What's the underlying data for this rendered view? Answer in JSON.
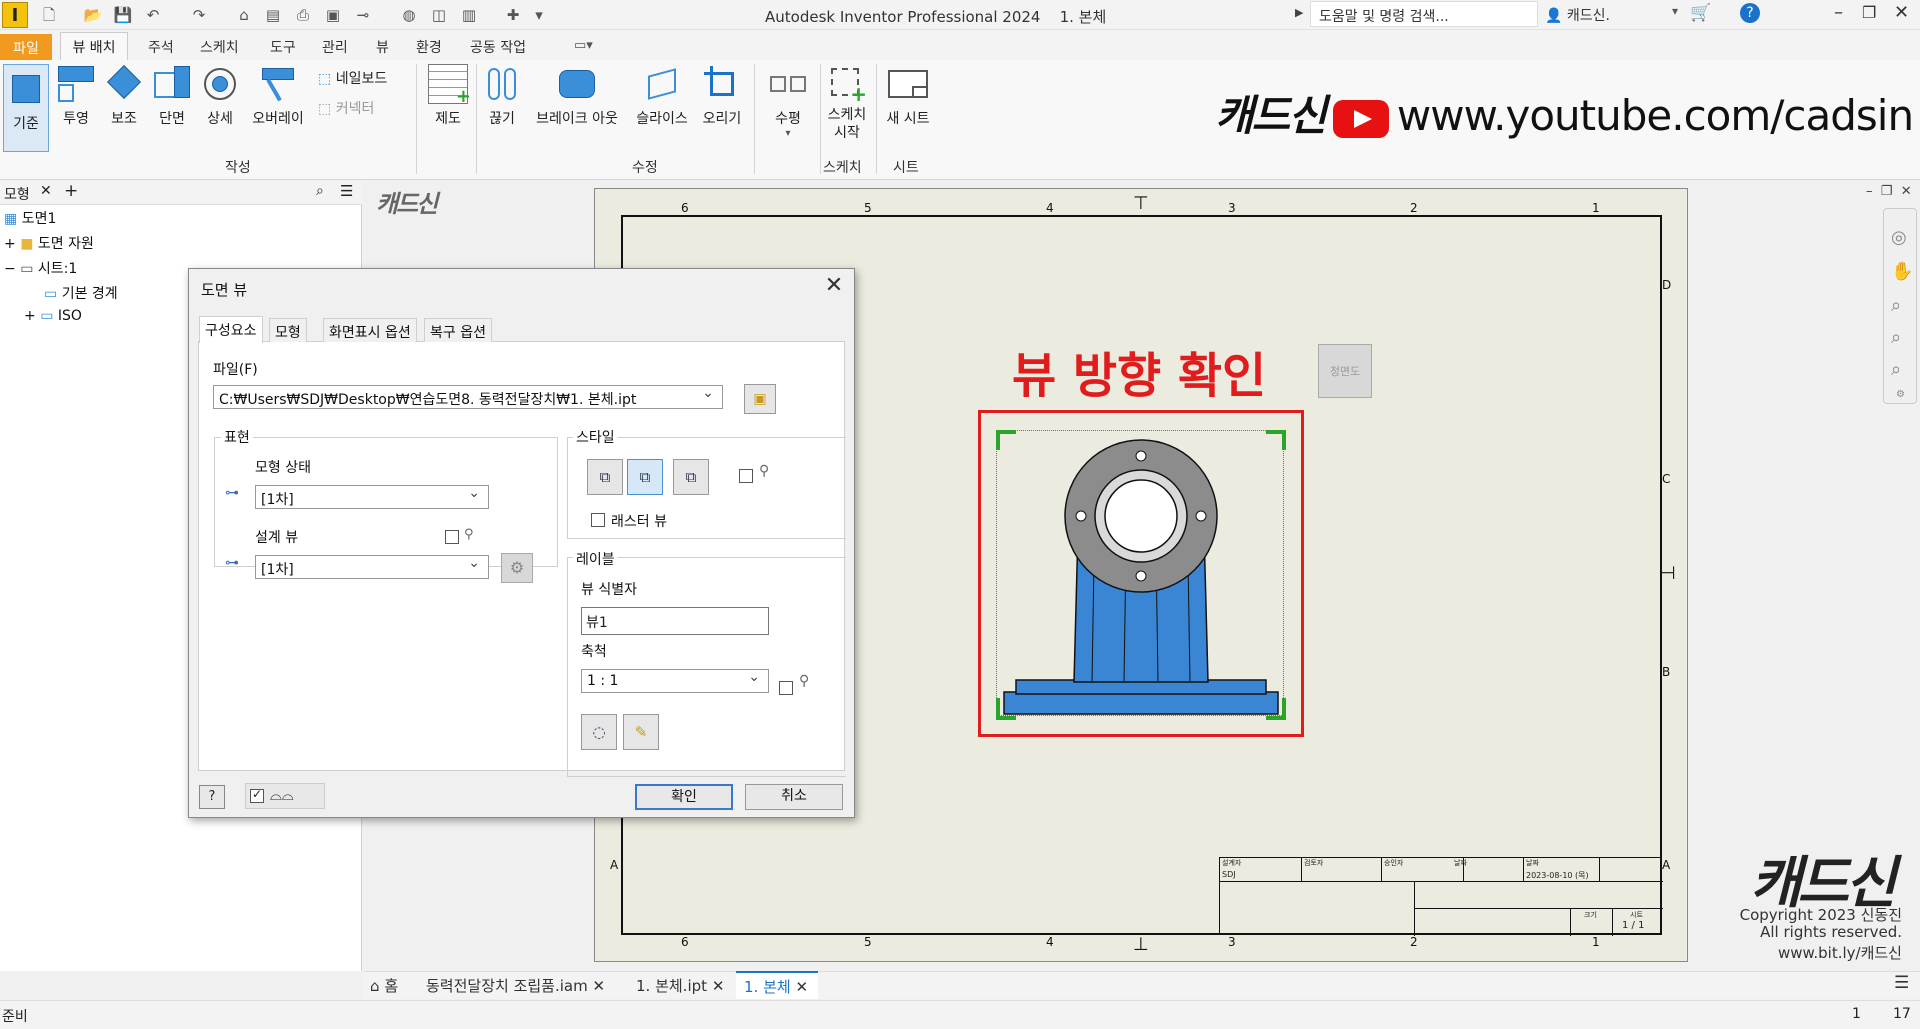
{
  "app": {
    "title": "Autodesk Inventor Professional 2024",
    "document": "1. 본체",
    "logo_letter": "I",
    "search_placeholder": "도움말 및 명령 검색...",
    "user": "캐드신."
  },
  "ribbon_tabs": [
    "파일",
    "뷰 배치",
    "주석",
    "스케치",
    "도구",
    "관리",
    "뷰",
    "환경",
    "공동 작업"
  ],
  "ribbon": {
    "create_buttons": [
      "기준",
      "투영",
      "보조",
      "단면",
      "상세",
      "오버레이"
    ],
    "small_buttons": [
      "네일보드",
      "커넥터"
    ],
    "draft_label": "제도",
    "modify_buttons": [
      "끊기",
      "브레이크 아웃",
      "슬라이스",
      "오리기"
    ],
    "align_label": "수평",
    "sketch_label_1": "스케치",
    "sketch_label_2": "시작",
    "new_sheet_label": "새 시트",
    "groups": {
      "create": "작성",
      "modify": "수정",
      "sketch": "스케치",
      "sheet": "시트"
    }
  },
  "brand": {
    "korean": "캐드신",
    "url": "www.youtube.com/cadsin"
  },
  "browser": {
    "tab": "모형",
    "tree": [
      "도면1",
      "도면 자원",
      "시트:1",
      "기본 경계",
      "ISO"
    ]
  },
  "canvas": {
    "watermark_top": "캐드신",
    "zone_cols": [
      "6",
      "5",
      "4",
      "3",
      "2",
      "1"
    ],
    "zone_rows": [
      "D",
      "C",
      "B",
      "A"
    ],
    "annotation": "뷰 방향 확인",
    "viewcube_label": "정면도",
    "titleblock": {
      "designer_h": "설계자",
      "checker_h": "검토자",
      "approver_h": "승인자",
      "date_h": "날짜",
      "date_h2": "날짜",
      "designer": "SDJ",
      "date": "2023-08-10 (목)",
      "sheet_h": "시트",
      "size_h": "크기",
      "sheet": "1 / 1"
    }
  },
  "watermark": {
    "logo": "캐드신",
    "copyright": "Copyright 2023 신동진",
    "rights": "All rights reserved.",
    "link": "www.bit.ly/캐드신"
  },
  "dialog": {
    "title": "도면 뷰",
    "tabs": [
      "구성요소",
      "모형",
      "화면표시 옵션",
      "복구 옵션"
    ],
    "file_label": "파일(F)",
    "file_path": "C:₩Users₩SDJ₩Desktop₩연습도면8. 동력전달장치₩1. 본체.ipt",
    "representation_label": "표현",
    "model_state_label": "모형 상태",
    "model_state_value": "[1차]",
    "design_view_label": "설계 뷰",
    "design_view_value": "[1차]",
    "style_label": "스타일",
    "raster_view_label": "래스터 뷰",
    "label_section": "레이블",
    "view_id_label": "뷰 식별자",
    "view_id_value": "뷰1",
    "scale_label": "축척",
    "scale_value": "1 : 1",
    "ok": "확인",
    "cancel": "취소"
  },
  "doc_tabs": [
    "홈",
    "동력전달장치 조립품.iam",
    "1. 본체.ipt",
    "1. 본체"
  ],
  "status": {
    "text": "준비",
    "n1": "1",
    "n2": "17"
  },
  "colors": {
    "file_tab": "#f29a1f",
    "accent": "#1a73c8",
    "annotation_red": "#e01c1c",
    "part_blue": "#3a86d4"
  }
}
